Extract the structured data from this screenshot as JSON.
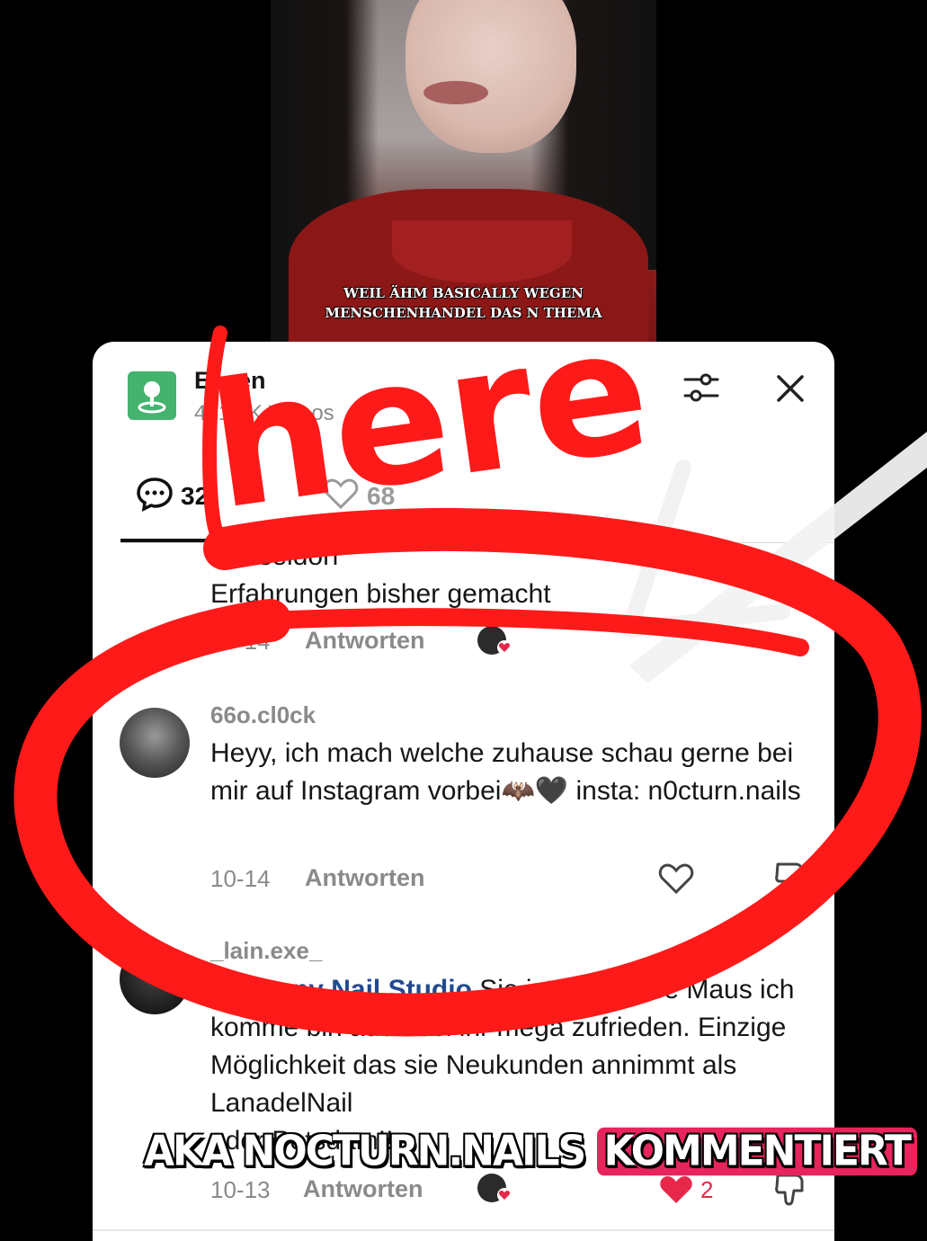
{
  "video": {
    "caption_line1": "WEIL ÄHM BASICALLY WEGEN",
    "caption_line2": "MENSCHENHANDEL DAS N THEMA"
  },
  "panel": {
    "title": "Essen",
    "subtitle": "431.7K Videos",
    "tabs": [
      {
        "label": "32",
        "icon": "comment-bubble-icon"
      },
      {
        "label": "68",
        "icon": "heart-outline-icon"
      }
    ]
  },
  "comments": [
    {
      "text_line1": "Düsseldorf",
      "text_line2": "Erfahrungen bisher gemacht",
      "date": "10-14",
      "reply": "Antworten"
    },
    {
      "user": "66o.cl0ck",
      "text": "Heyy, ich mach welche zuhause schau gerne bei mir auf Instagram vorbei🦇🖤 insta: n0cturn.nails",
      "date": "10-14",
      "reply": "Antworten"
    },
    {
      "user": "_lain.exe_",
      "mention": "@Moony Nail Studio",
      "text_after_mention": " Sie ist eine süße Maus ich komme bin auch bei ihr mega zufrieden. Einzige Möglichkeit das sie Neukunden annimmt als LanadelNail",
      "text_line5": "oder Potsdam!!",
      "date": "10-13",
      "reply": "Antworten",
      "likes": "2"
    }
  ],
  "overlay": {
    "scribble_word": "here",
    "banner_text": "AKA NOCTURN.NAILS",
    "banner_highlight": "KOMMENTIERT"
  },
  "colors": {
    "accent_red": "#ff1a1a",
    "banner_pink": "#e8245c",
    "like_red": "#e8284a",
    "mention_blue": "#24498f"
  }
}
